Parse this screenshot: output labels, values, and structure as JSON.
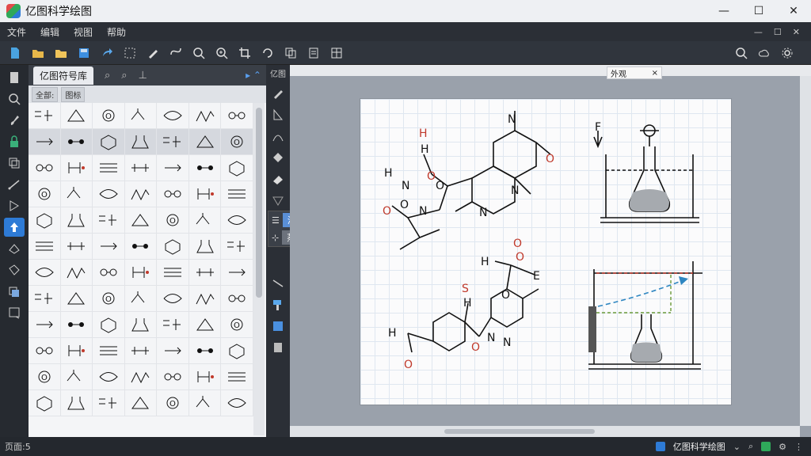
{
  "window": {
    "title": "亿图科学绘图",
    "minimize": "—",
    "maximize": "☐",
    "close": "✕"
  },
  "menu": {
    "items": [
      "文件",
      "编辑",
      "视图",
      "帮助"
    ],
    "right_buttons": [
      "—",
      "☐",
      "✕"
    ]
  },
  "library": {
    "tab_label": "亿图符号库",
    "filter_select": "全部:",
    "filter_select2": "图标"
  },
  "doc_panel": {
    "label": "亿图"
  },
  "doc_tab": {
    "label": "外观",
    "close": "×"
  },
  "float_panel": {
    "row1": "溶液",
    "row2": "蒸馏"
  },
  "status": {
    "left": "页面:5",
    "app_name": "亿图科学绘图"
  },
  "colors": {
    "accent": "#2e7bd6",
    "molecule_red": "#c0392b",
    "arrow_blue": "#2e86c1"
  }
}
